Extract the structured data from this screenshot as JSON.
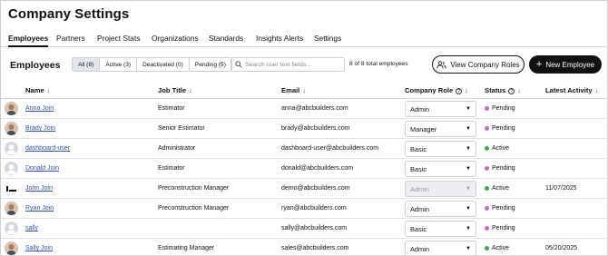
{
  "page": {
    "title": "Company Settings"
  },
  "tabs": [
    "Employees",
    "Partners",
    "Project Stats",
    "Organizations",
    "Standards",
    "Insights Alerts",
    "Settings"
  ],
  "section": {
    "title": "Employees",
    "filters": [
      "All (8)",
      "Active (3)",
      "Deactivated (0)",
      "Pending (5)"
    ],
    "search_placeholder": "Search user text fields...",
    "total": "8 of 8 total employees",
    "roles_button": "View Company Roles",
    "new_button": "New Employee",
    "new_button_plus": "+"
  },
  "table": {
    "headers": {
      "name": "Name",
      "job": "Job Title",
      "email": "Email",
      "role": "Company Role",
      "status": "Status",
      "activity": "Latest Activity"
    },
    "sort_glyph": "↓",
    "info_glyph": "?",
    "caret_glyph": "▼",
    "rows": [
      {
        "avatar": "photo",
        "name": "Anna Join",
        "job": "Estimator",
        "email": "anna@abcbuilders.com",
        "role": "Admin",
        "status": "Pending",
        "activity": ""
      },
      {
        "avatar": "photo",
        "name": "Brady Join",
        "job": "Senior Estimator",
        "email": "brady@abcbuilders.com",
        "role": "Manager",
        "status": "Pending",
        "activity": ""
      },
      {
        "avatar": "placeholder",
        "name": "dashboard-user",
        "job": "Administrator",
        "email": "dashboard-user@abcbuilders.com",
        "role": "Basic",
        "status": "Active",
        "activity": ""
      },
      {
        "avatar": "placeholder",
        "name": "Donald Join",
        "job": "Estimator",
        "email": "donald@abcbuilders.com",
        "role": "Basic",
        "status": "Pending",
        "activity": ""
      },
      {
        "avatar": "logo",
        "name": "John Join",
        "job": "Preconstruction Manager",
        "email": "demo@abcbuilders.com",
        "role": "Admin",
        "role_disabled": true,
        "status": "Active",
        "activity": "11/07/2025"
      },
      {
        "avatar": "photo",
        "name": "Ryan Join",
        "job": "Preconstruction Manager",
        "email": "ryan@abcbuilders.com",
        "role": "Admin",
        "status": "Pending",
        "activity": ""
      },
      {
        "avatar": "placeholder",
        "name": "sally",
        "job": "",
        "email": "sally@abcbuilders.com",
        "role": "Basic",
        "status": "Pending",
        "activity": ""
      },
      {
        "avatar": "photo",
        "name": "Sally Join",
        "job": "Estimating Manager",
        "email": "sales@abcbuilders.com",
        "role": "Admin",
        "status": "Active",
        "activity": "05/20/2025"
      }
    ]
  },
  "colors": {
    "active": "#3fa84a",
    "pending": "#c66bc0",
    "link": "#2f4fb0"
  }
}
